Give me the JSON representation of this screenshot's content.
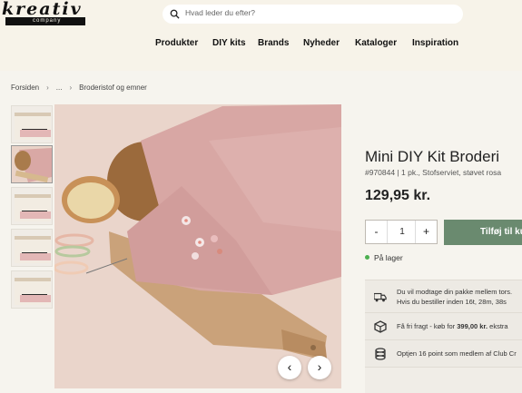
{
  "brand": {
    "logo_text": "kreativ",
    "logo_sub": "company"
  },
  "search": {
    "placeholder": "Hvad leder du efter?"
  },
  "nav": [
    "Produkter",
    "DIY kits",
    "Brands",
    "Nyheder",
    "Kataloger",
    "Inspiration"
  ],
  "breadcrumb": [
    "Forsiden",
    "...",
    "Broderistof og emner"
  ],
  "product": {
    "title": "Mini DIY Kit Broderi",
    "meta": "#970844 | 1 pk., Stofserviet, støvet rosa",
    "price": "129,95 kr.",
    "quantity": "1",
    "add_to_cart": "Tilføj til kurv",
    "stock": "På lager"
  },
  "info_rows": [
    {
      "icon": "truck-icon",
      "line1": "Du vil modtage din pakke mellem tors.",
      "line2": "Hvis du bestiller inden 16t, 28m, 38s"
    },
    {
      "icon": "box-icon",
      "prefix": "Få fri fragt - køb for ",
      "bold": "399,00 kr.",
      "suffix": " ekstra"
    },
    {
      "icon": "coins-icon",
      "line1": "Optjen 16 point som medlem af  Club Cr"
    }
  ],
  "controls": {
    "prev": "‹",
    "next": "›",
    "minus": "-",
    "plus": "+"
  },
  "colors": {
    "button_green": "#6a8a6f",
    "stock_green": "#4caf50",
    "page_bg": "#f6f4ee"
  }
}
